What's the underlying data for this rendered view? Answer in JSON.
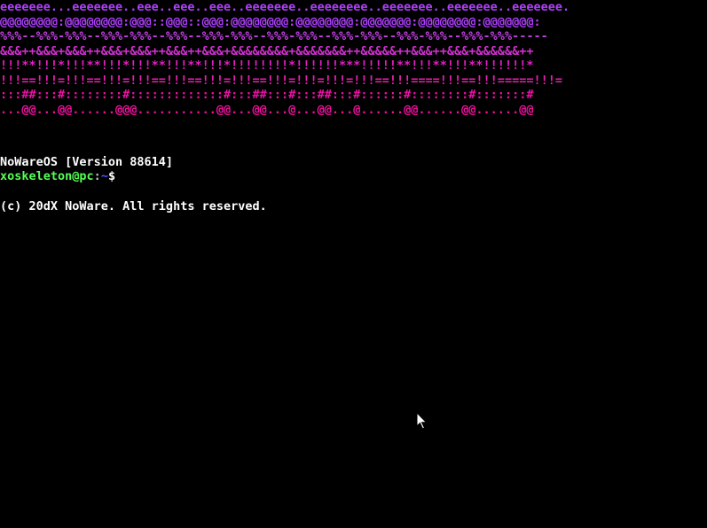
{
  "banner": {
    "lines": [
      {
        "text": "eeeeeee...eeeeeee..eee..eee..eee..eeeeeee..eeeeeeee..eeeeeee..eeeeeee..eeeeeee.",
        "color": "#b040ff"
      },
      {
        "text": "@@@@@@@@:@@@@@@@@:@@@::@@@::@@@:@@@@@@@@:@@@@@@@@:@@@@@@@:@@@@@@@@:@@@@@@@:",
        "color": "#b040ff"
      },
      {
        "text": "%%%--%%%-%%%--%%%-%%%--%%%--%%%-%%%--%%%-%%%--%%%-%%%--%%%-%%%--%%%-%%%-----",
        "color": "#c040e0"
      },
      {
        "text": "&&&++&&&+&&&++&&&+&&&++&&&++&&&+&&&&&&&&+&&&&&&&++&&&&&++&&&++&&&+&&&&&&++",
        "color": "#d030d0"
      },
      {
        "text": "!!!**!!!*!!!**!!!*!!!**!!!**!!!*!!!!!!!!*!!!!!!***!!!!!**!!!**!!!**!!!!!!*",
        "color": "#e020c0"
      },
      {
        "text": "!!!==!!!=!!!==!!!=!!!==!!!==!!!=!!!==!!!=!!!=!!!=!!!==!!!====!!!==!!!=====!!!=",
        "color": "#e820b0"
      },
      {
        "text": ":::##:::#::::::::#:::::::::::::#:::##:::#:::##:::#::::::#::::::::#:::::::#",
        "color": "#ee10a8"
      },
      {
        "text": "...@@...@@......@@@...........@@...@@...@...@@...@......@@......@@......@@",
        "color": "#f010a0"
      }
    ]
  },
  "info": {
    "version_line": "NoWareOS [Version 88614]",
    "copyright_line": "(c) 20dX NoWare. All rights reserved."
  },
  "prompt": {
    "user_host": "xoskeleton@pc",
    "separator": ":",
    "path": "~",
    "symbol": "$"
  }
}
